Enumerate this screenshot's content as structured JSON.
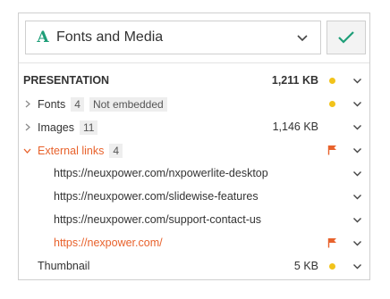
{
  "header": {
    "app_icon_glyph": "A",
    "title": "Fonts and Media",
    "dropdown_icon": "chevron-down-icon",
    "confirm_icon": "checkmark-icon"
  },
  "colors": {
    "accent_green": "#1e9e78",
    "external_orange": "#e8622c",
    "status_yellow": "#f2c31a"
  },
  "presentation": {
    "label": "PRESENTATION",
    "size": "1,211 KB",
    "status": "yellow-dot"
  },
  "fonts": {
    "label": "Fonts",
    "count": "4",
    "badge": "Not embedded",
    "status": "yellow-dot"
  },
  "images": {
    "label": "Images",
    "count": "11",
    "size": "1,146 KB"
  },
  "external_links": {
    "label": "External links",
    "count": "4",
    "status": "orange-flag",
    "links": [
      {
        "url": "https://neuxpower.com/nxpowerlite-desktop",
        "broken": false
      },
      {
        "url": "https://neuxpower.com/slidewise-features",
        "broken": false
      },
      {
        "url": "https://neuxpower.com/support-contact-us",
        "broken": false
      },
      {
        "url": "https://nexpower.com/",
        "broken": true,
        "status": "orange-flag"
      }
    ]
  },
  "thumbnail": {
    "label": "Thumbnail",
    "size": "5 KB",
    "status": "yellow-dot"
  }
}
